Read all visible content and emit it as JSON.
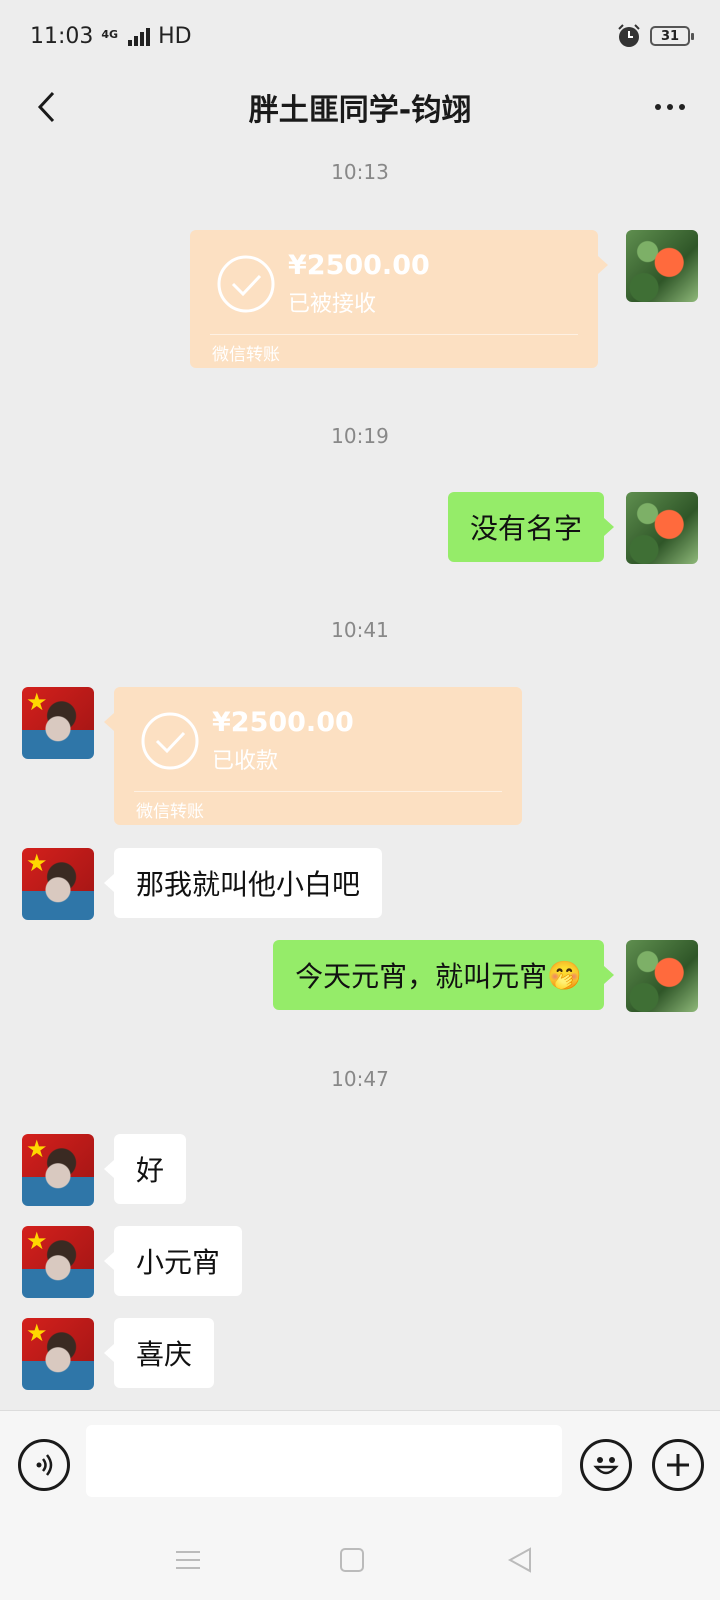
{
  "status_bar": {
    "time": "11:03",
    "network_type": "4G",
    "hd_label": "HD",
    "battery": "31"
  },
  "header": {
    "title": "胖土匪同学-钧翊"
  },
  "messages": {
    "time_1": "10:13",
    "transfer_1": {
      "amount": "¥2500.00",
      "status": "已被接收",
      "kind": "微信转账"
    },
    "time_2": "10:19",
    "msg_1": "没有名字",
    "time_3": "10:41",
    "transfer_2": {
      "amount": "¥2500.00",
      "status": "已收款",
      "kind": "微信转账"
    },
    "msg_2": "那我就叫他小白吧",
    "msg_3": "今天元宵，就叫元宵",
    "msg_3_emoji": "🤭",
    "time_4": "10:47",
    "msg_4": "好",
    "msg_5": "小元宵",
    "msg_6": "喜庆"
  },
  "colors": {
    "sent_bubble": "#95ec69",
    "received_bubble": "#ffffff",
    "transfer_card": "#fce0c2",
    "background": "#ededed"
  },
  "icons": {
    "back": "chevron-left-icon",
    "more": "more-dots-icon",
    "voice": "voice-icon",
    "emoji": "emoji-icon",
    "plus": "plus-icon"
  }
}
